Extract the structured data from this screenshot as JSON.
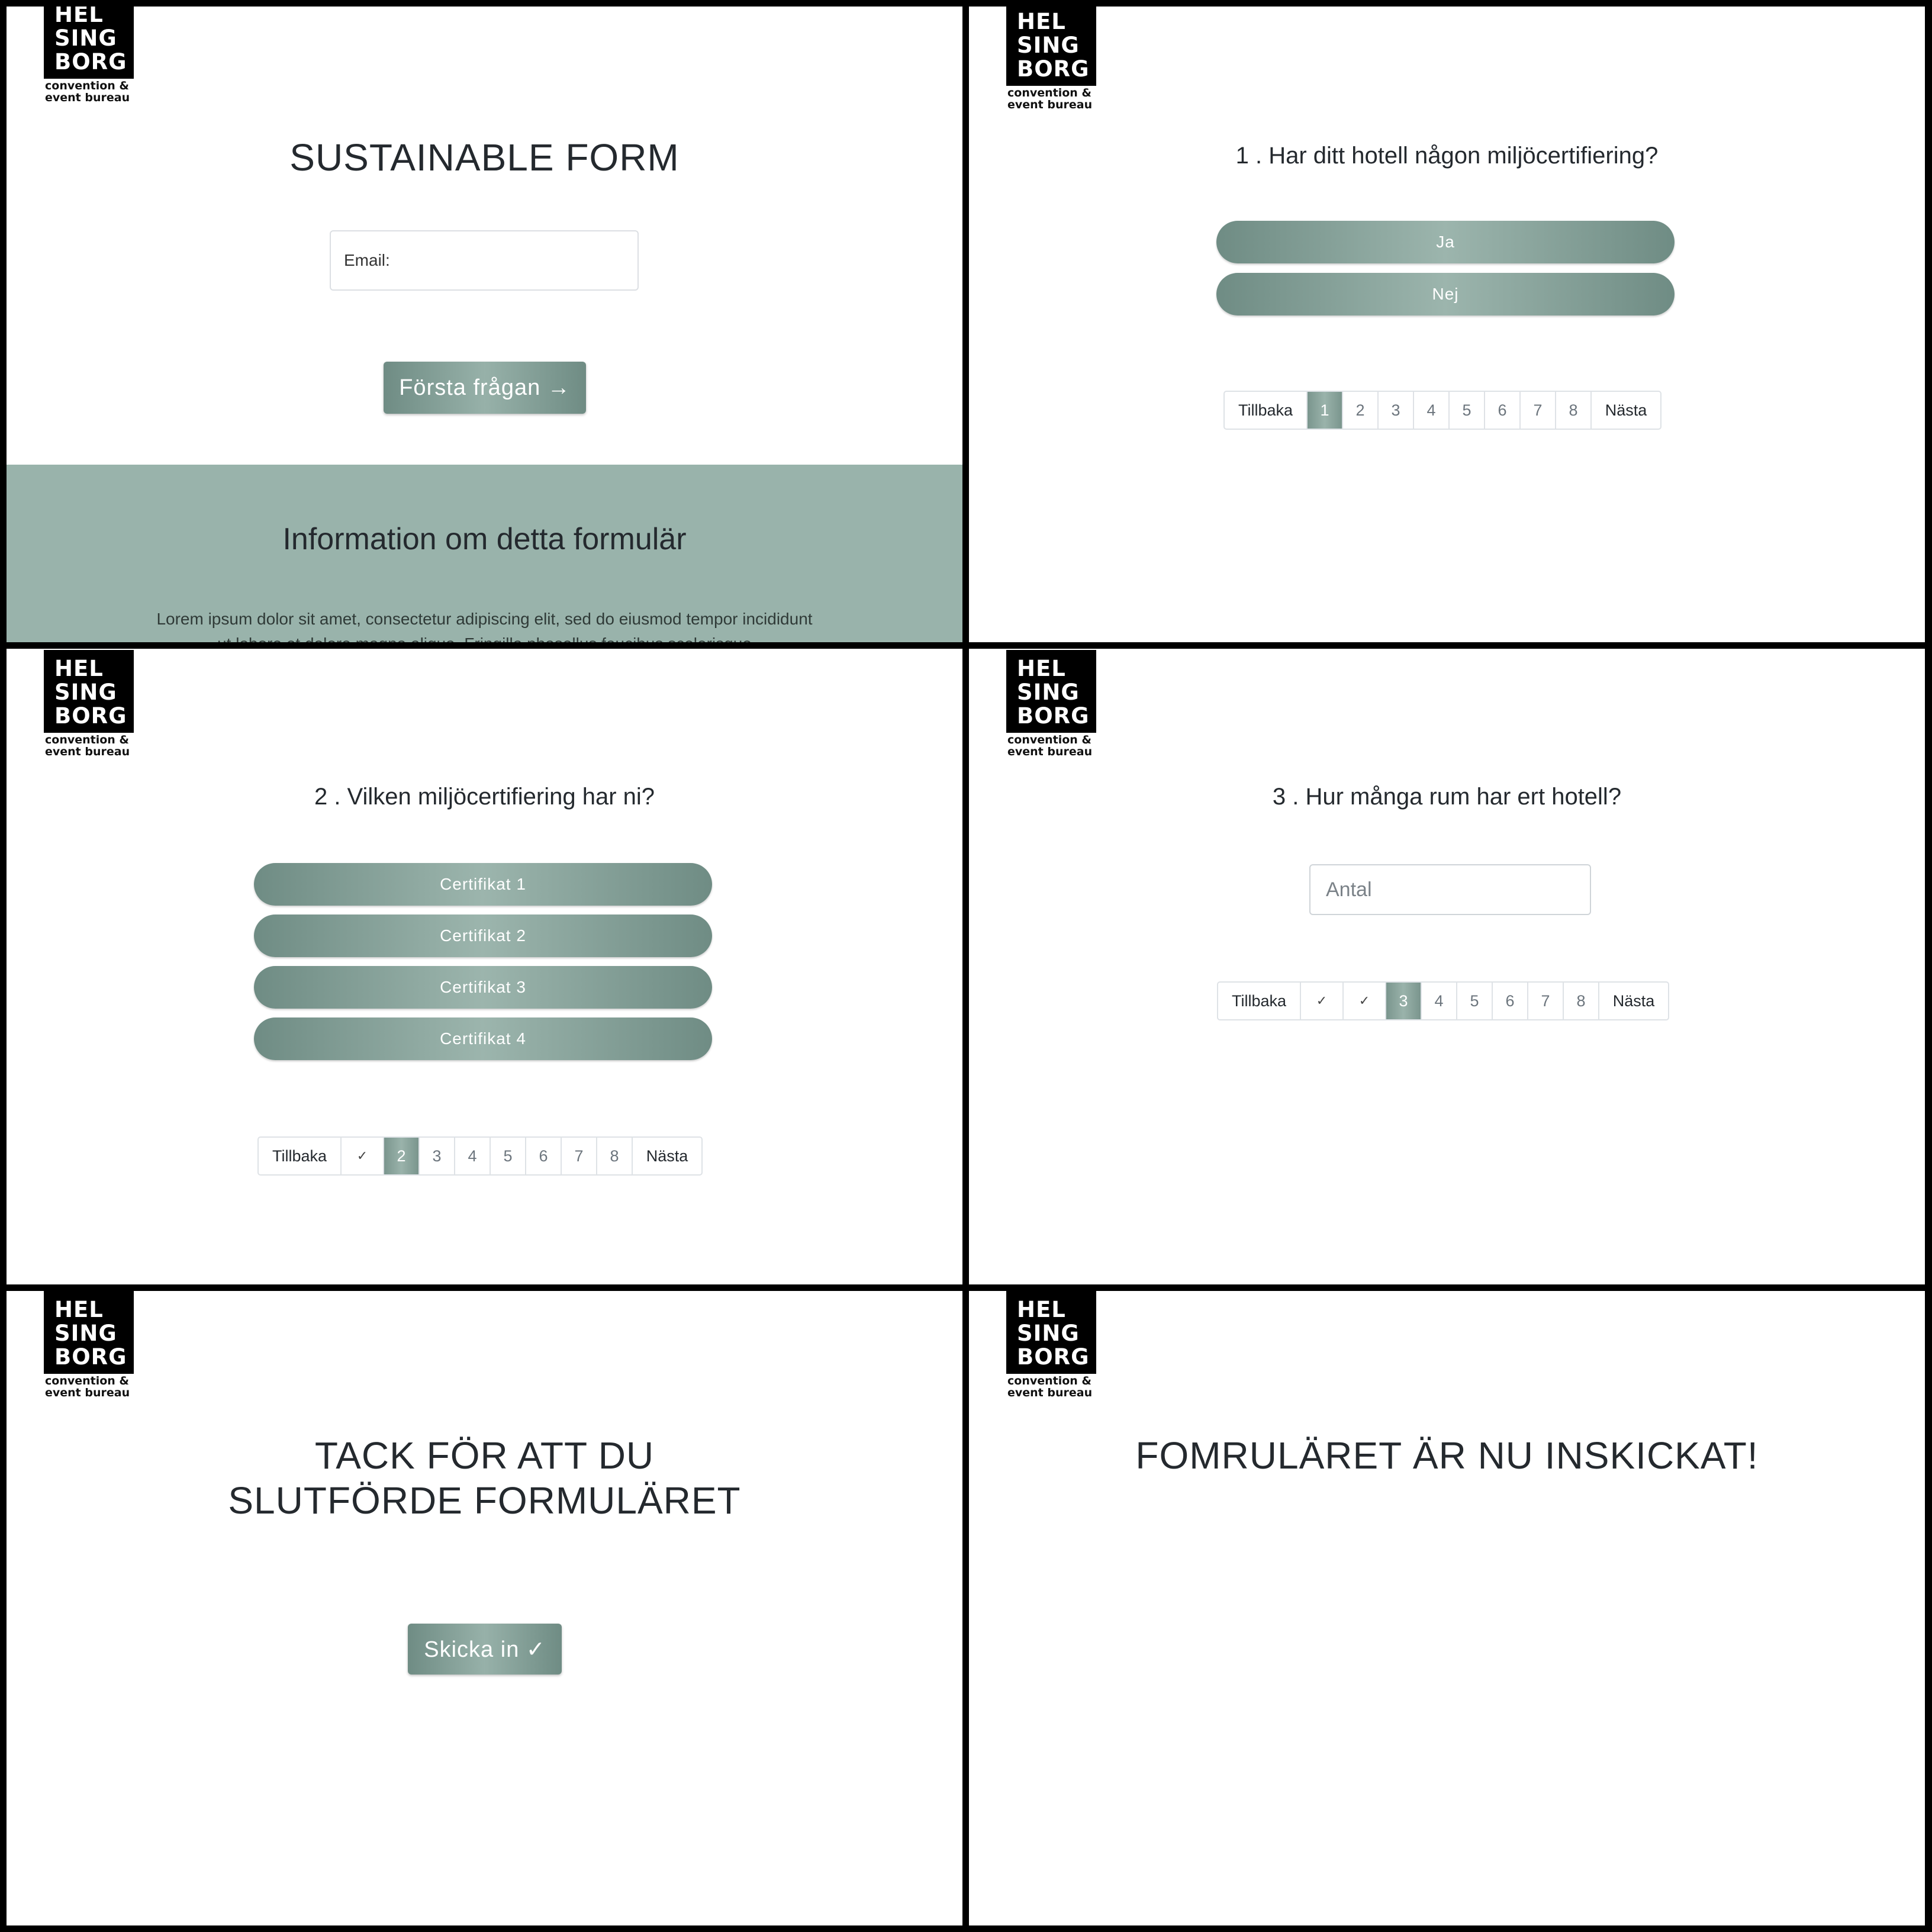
{
  "logo": {
    "lines": [
      "HEL",
      "SING",
      "BORG"
    ],
    "sub1": "convention &",
    "sub2": "event bureau"
  },
  "screen1": {
    "title": "SUSTAINABLE FORM",
    "email_label": "Email:",
    "first_button": "Första frågan →",
    "info_title": "Information om detta formulär",
    "info_text": "Lorem ipsum dolor sit amet, consectetur adipiscing elit, sed do eiusmod tempor incididunt ut labore et dolore magna aliqua. Fringilla phasellus faucibus scelerisque"
  },
  "screen2": {
    "question": "1 . Har ditt hotell någon miljöcertifiering?",
    "options": [
      "Ja",
      "Nej"
    ],
    "pager": [
      "Tillbaka",
      "1",
      "2",
      "3",
      "4",
      "5",
      "6",
      "7",
      "8",
      "Nästa"
    ]
  },
  "screen3": {
    "question": "2 . Vilken miljöcertifiering har ni?",
    "options": [
      "Certifikat 1",
      "Certifikat 2",
      "Certifikat 3",
      "Certifikat 4"
    ],
    "pager": [
      "Tillbaka",
      "✓",
      "2",
      "3",
      "4",
      "5",
      "6",
      "7",
      "8",
      "Nästa"
    ]
  },
  "screen4": {
    "question": "3 . Hur många rum har ert hotell?",
    "input_placeholder": "Antal",
    "pager": [
      "Tillbaka",
      "✓",
      "✓",
      "3",
      "4",
      "5",
      "6",
      "7",
      "8",
      "Nästa"
    ]
  },
  "screen5": {
    "title_line1": "TACK FÖR ATT DU",
    "title_line2": "SLUTFÖRDE FORMULÄRET",
    "submit_button": "Skicka in ✓"
  },
  "screen6": {
    "title": "FOMRULÄRET ÄR NU INSKICKAT!"
  },
  "colors": {
    "accent": "#99b3ab",
    "accent_dark": "#6f8c84",
    "text": "#24292e"
  }
}
